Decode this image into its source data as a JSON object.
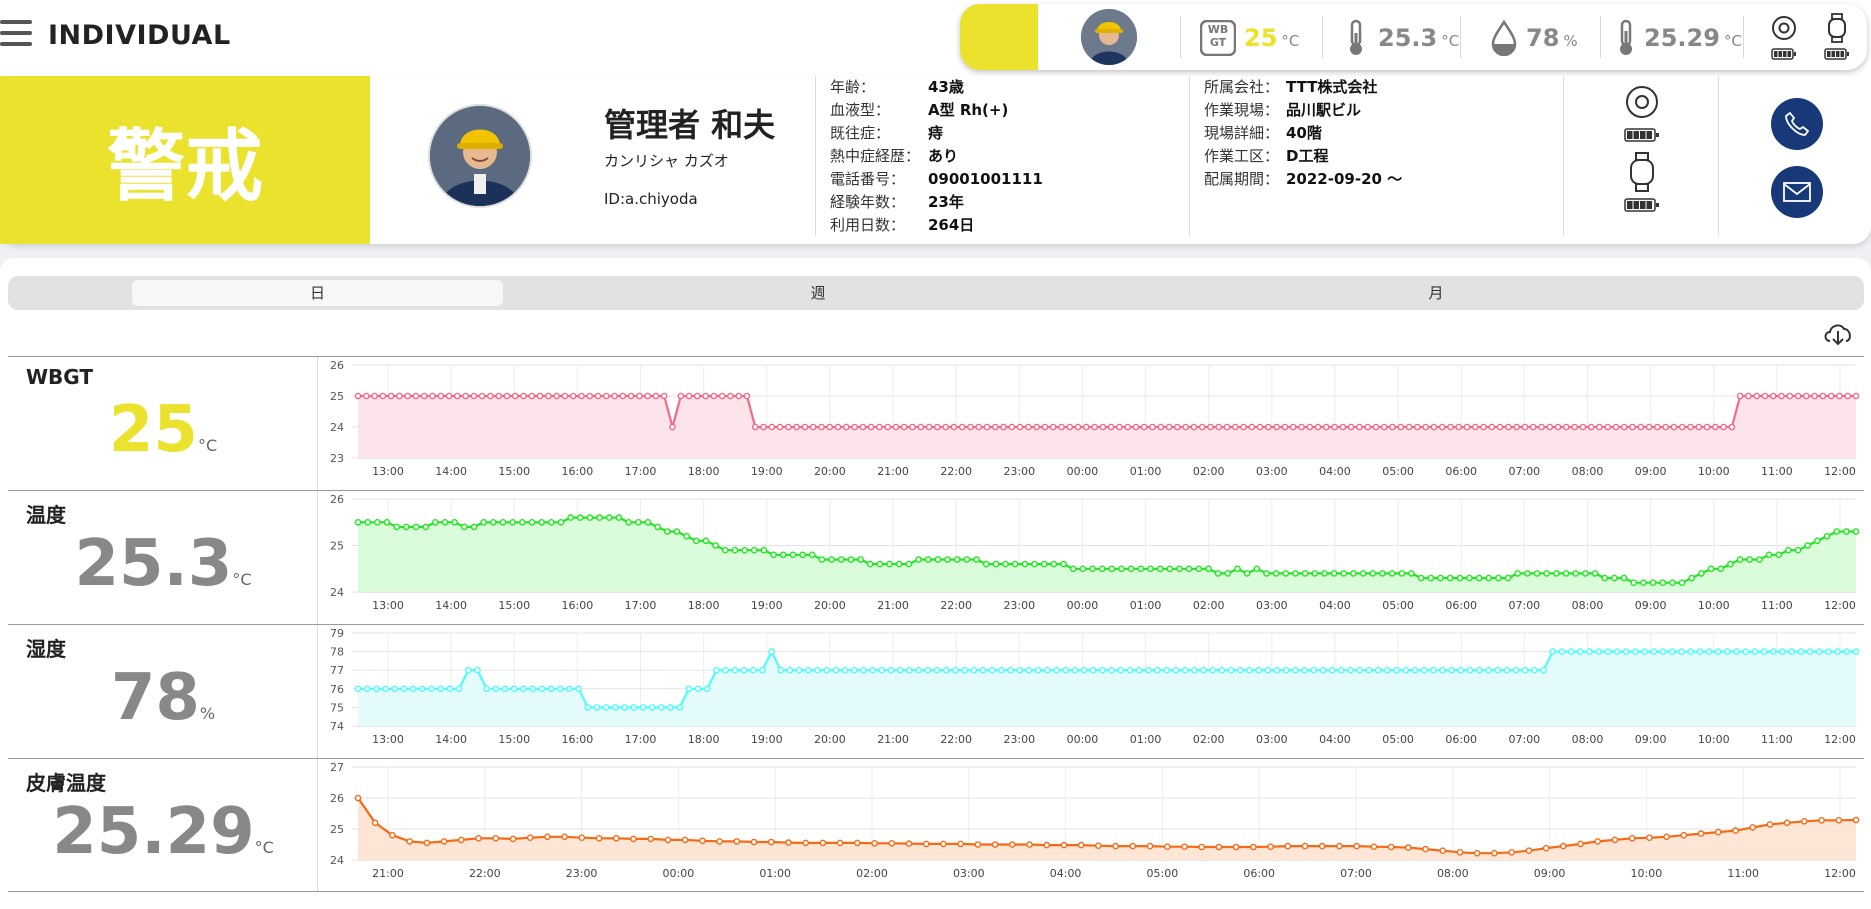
{
  "app": {
    "title": "INDIVIDUAL"
  },
  "status_bar": {
    "wbgt_icon_text": "WB GT",
    "wbgt": {
      "value": "25",
      "unit": "°C"
    },
    "temperature": {
      "value": "25.3",
      "unit": "°C"
    },
    "humidity": {
      "value": "78",
      "unit": "%"
    },
    "skin_temperature": {
      "value": "25.29",
      "unit": "°C"
    },
    "colors": {
      "alert": "#ebe22e"
    }
  },
  "profile": {
    "alert_level": "警戒",
    "name": "管理者 和夫",
    "kana": "カンリシャ カズオ",
    "id": "ID:a.chiyoda",
    "personal": [
      {
        "label": "年齢：",
        "value": "43歳"
      },
      {
        "label": "血液型：",
        "value": "A型 Rh(+)"
      },
      {
        "label": "既往症：",
        "value": "痔"
      },
      {
        "label": "熱中症経歴：",
        "value": "あり"
      },
      {
        "label": "電話番号：",
        "value": "09001001111"
      },
      {
        "label": "経験年数：",
        "value": "23年"
      },
      {
        "label": "利用日数：",
        "value": "264日"
      }
    ],
    "work": [
      {
        "label": "所属会社：",
        "value": "TTT株式会社"
      },
      {
        "label": "作業現場：",
        "value": "品川駅ビル"
      },
      {
        "label": "現場詳細：",
        "value": "40階"
      },
      {
        "label": "作業工区：",
        "value": "D工程"
      },
      {
        "label": "配属期間：",
        "value": "2022-09-20 〜"
      }
    ]
  },
  "tabs": [
    {
      "label": "日",
      "active": true
    },
    {
      "label": "週",
      "active": false
    },
    {
      "label": "月",
      "active": false
    }
  ],
  "panels": {
    "wbgt": {
      "label": "WBGT",
      "value": "25",
      "unit": "°C"
    },
    "temp": {
      "label": "温度",
      "value": "25.3",
      "unit": "°C"
    },
    "humid": {
      "label": "湿度",
      "value": "78",
      "unit": "%"
    },
    "skin": {
      "label": "皮膚温度",
      "value": "25.29",
      "unit": "°C"
    }
  },
  "chart_data": [
    {
      "type": "area",
      "name": "wbgt",
      "color": "#f06b8a",
      "fill": "#fde3ea",
      "ylim": [
        23,
        26
      ],
      "yticks": [
        "23",
        "24",
        "25",
        "26"
      ],
      "xticks": [
        "13:00",
        "14:00",
        "15:00",
        "16:00",
        "17:00",
        "18:00",
        "19:00",
        "20:00",
        "21:00",
        "22:00",
        "23:00",
        "00:00",
        "01:00",
        "02:00",
        "03:00",
        "04:00",
        "05:00",
        "06:00",
        "07:00",
        "08:00",
        "09:00",
        "10:00",
        "11:00",
        "12:00"
      ],
      "values": [
        25,
        25,
        25,
        25,
        25,
        25,
        25,
        25,
        25,
        25,
        25,
        25,
        25,
        25,
        25,
        25,
        25,
        25,
        25,
        25,
        25,
        25,
        25,
        25,
        25,
        25,
        25,
        25,
        25,
        25,
        25,
        25,
        25,
        25,
        25,
        25,
        25,
        25,
        24,
        25,
        25,
        25,
        25,
        25,
        25,
        25,
        25,
        25,
        24,
        24,
        24,
        24,
        24,
        24,
        24,
        24,
        24,
        24,
        24,
        24,
        24,
        24,
        24,
        24,
        24,
        24,
        24,
        24,
        24,
        24,
        24,
        24,
        24,
        24,
        24,
        24,
        24,
        24,
        24,
        24,
        24,
        24,
        24,
        24,
        24,
        24,
        24,
        24,
        24,
        24,
        24,
        24,
        24,
        24,
        24,
        24,
        24,
        24,
        24,
        24,
        24,
        24,
        24,
        24,
        24,
        24,
        24,
        24,
        24,
        24,
        24,
        24,
        24,
        24,
        24,
        24,
        24,
        24,
        24,
        24,
        24,
        24,
        24,
        24,
        24,
        24,
        24,
        24,
        24,
        24,
        24,
        24,
        24,
        24,
        24,
        24,
        24,
        24,
        24,
        24,
        24,
        24,
        24,
        24,
        24,
        24,
        24,
        24,
        24,
        24,
        24,
        24,
        24,
        24,
        24,
        24,
        24,
        24,
        24,
        24,
        24,
        24,
        24,
        24,
        24,
        24,
        24,
        25,
        25,
        25,
        25,
        25,
        25,
        25,
        25,
        25,
        25,
        25,
        25,
        25,
        25,
        25
      ]
    },
    {
      "type": "area",
      "name": "temp",
      "color": "#1ee81e",
      "fill": "#dafcda",
      "ylim": [
        24,
        26
      ],
      "yticks": [
        "24",
        "25",
        "26"
      ],
      "xticks": [
        "13:00",
        "14:00",
        "15:00",
        "16:00",
        "17:00",
        "18:00",
        "19:00",
        "20:00",
        "21:00",
        "22:00",
        "23:00",
        "00:00",
        "01:00",
        "02:00",
        "03:00",
        "04:00",
        "05:00",
        "06:00",
        "07:00",
        "08:00",
        "09:00",
        "10:00",
        "11:00",
        "12:00"
      ],
      "values": [
        25.5,
        25.5,
        25.5,
        25.5,
        25.4,
        25.4,
        25.4,
        25.4,
        25.5,
        25.5,
        25.5,
        25.4,
        25.4,
        25.5,
        25.5,
        25.5,
        25.5,
        25.5,
        25.5,
        25.5,
        25.5,
        25.5,
        25.6,
        25.6,
        25.6,
        25.6,
        25.6,
        25.6,
        25.5,
        25.5,
        25.5,
        25.4,
        25.3,
        25.3,
        25.2,
        25.1,
        25.1,
        25.0,
        24.9,
        24.9,
        24.9,
        24.9,
        24.9,
        24.8,
        24.8,
        24.8,
        24.8,
        24.8,
        24.7,
        24.7,
        24.7,
        24.7,
        24.7,
        24.6,
        24.6,
        24.6,
        24.6,
        24.6,
        24.7,
        24.7,
        24.7,
        24.7,
        24.7,
        24.7,
        24.7,
        24.6,
        24.6,
        24.6,
        24.6,
        24.6,
        24.6,
        24.6,
        24.6,
        24.6,
        24.5,
        24.5,
        24.5,
        24.5,
        24.5,
        24.5,
        24.5,
        24.5,
        24.5,
        24.5,
        24.5,
        24.5,
        24.5,
        24.5,
        24.5,
        24.4,
        24.4,
        24.5,
        24.4,
        24.5,
        24.4,
        24.4,
        24.4,
        24.4,
        24.4,
        24.4,
        24.4,
        24.4,
        24.4,
        24.4,
        24.4,
        24.4,
        24.4,
        24.4,
        24.4,
        24.4,
        24.3,
        24.3,
        24.3,
        24.3,
        24.3,
        24.3,
        24.3,
        24.3,
        24.3,
        24.3,
        24.4,
        24.4,
        24.4,
        24.4,
        24.4,
        24.4,
        24.4,
        24.4,
        24.4,
        24.3,
        24.3,
        24.3,
        24.2,
        24.2,
        24.2,
        24.2,
        24.2,
        24.2,
        24.3,
        24.4,
        24.5,
        24.5,
        24.6,
        24.7,
        24.7,
        24.7,
        24.8,
        24.8,
        24.9,
        24.9,
        25.0,
        25.1,
        25.2,
        25.3,
        25.3,
        25.3
      ]
    },
    {
      "type": "area",
      "name": "humid",
      "color": "#4dfcfc",
      "fill": "#e3fbfb",
      "ylim": [
        74,
        79
      ],
      "yticks": [
        "74",
        "75",
        "76",
        "77",
        "78",
        "79"
      ],
      "xticks": [
        "13:00",
        "14:00",
        "15:00",
        "16:00",
        "17:00",
        "18:00",
        "19:00",
        "20:00",
        "21:00",
        "22:00",
        "23:00",
        "00:00",
        "01:00",
        "02:00",
        "03:00",
        "04:00",
        "05:00",
        "06:00",
        "07:00",
        "08:00",
        "09:00",
        "10:00",
        "11:00",
        "12:00"
      ],
      "values": [
        76,
        76,
        76,
        76,
        76,
        76,
        76,
        76,
        76,
        76,
        76,
        76,
        77,
        77,
        76,
        76,
        76,
        76,
        76,
        76,
        76,
        76,
        76,
        76,
        76,
        75,
        75,
        75,
        75,
        75,
        75,
        75,
        75,
        75,
        75,
        75,
        76,
        76,
        76,
        77,
        77,
        77,
        77,
        77,
        77,
        78,
        77,
        77,
        77,
        77,
        77,
        77,
        77,
        77,
        77,
        77,
        77,
        77,
        77,
        77,
        77,
        77,
        77,
        77,
        77,
        77,
        77,
        77,
        77,
        77,
        77,
        77,
        77,
        77,
        77,
        77,
        77,
        77,
        77,
        77,
        77,
        77,
        77,
        77,
        77,
        77,
        77,
        77,
        77,
        77,
        77,
        77,
        77,
        77,
        77,
        77,
        77,
        77,
        77,
        77,
        77,
        77,
        77,
        77,
        77,
        77,
        77,
        77,
        77,
        77,
        77,
        77,
        77,
        77,
        77,
        77,
        77,
        77,
        77,
        77,
        77,
        77,
        77,
        77,
        77,
        77,
        77,
        77,
        77,
        77,
        78,
        78,
        78,
        78,
        78,
        78,
        78,
        78,
        78,
        78,
        78,
        78,
        78,
        78,
        78,
        78,
        78,
        78,
        78,
        78,
        78,
        78,
        78,
        78,
        78,
        78,
        78,
        78,
        78,
        78,
        78,
        78,
        78,
        78
      ]
    },
    {
      "type": "area",
      "name": "skin",
      "color": "#f56a14",
      "fill": "#fde6d6",
      "ylim": [
        24,
        27
      ],
      "yticks": [
        "24",
        "25",
        "26",
        "27"
      ],
      "xticks": [
        "21:00",
        "22:00",
        "23:00",
        "00:00",
        "01:00",
        "02:00",
        "03:00",
        "04:00",
        "05:00",
        "06:00",
        "07:00",
        "08:00",
        "09:00",
        "10:00",
        "11:00",
        "12:00"
      ],
      "values": [
        26.0,
        25.2,
        24.8,
        24.6,
        24.55,
        24.6,
        24.65,
        24.7,
        24.7,
        24.68,
        24.72,
        24.75,
        24.75,
        24.72,
        24.7,
        24.7,
        24.68,
        24.68,
        24.65,
        24.65,
        24.62,
        24.6,
        24.6,
        24.58,
        24.58,
        24.56,
        24.55,
        24.55,
        24.55,
        24.55,
        24.54,
        24.54,
        24.53,
        24.52,
        24.52,
        24.52,
        24.5,
        24.5,
        24.5,
        24.5,
        24.48,
        24.48,
        24.48,
        24.46,
        24.45,
        24.45,
        24.45,
        24.43,
        24.43,
        24.42,
        24.42,
        24.42,
        24.42,
        24.43,
        24.45,
        24.45,
        24.45,
        24.45,
        24.45,
        24.43,
        24.42,
        24.4,
        24.35,
        24.3,
        24.25,
        24.22,
        24.22,
        24.25,
        24.3,
        24.38,
        24.45,
        24.52,
        24.6,
        24.65,
        24.7,
        24.72,
        24.75,
        24.8,
        24.85,
        24.9,
        24.95,
        25.05,
        25.15,
        25.2,
        25.25,
        25.28,
        25.28,
        25.29
      ]
    }
  ]
}
